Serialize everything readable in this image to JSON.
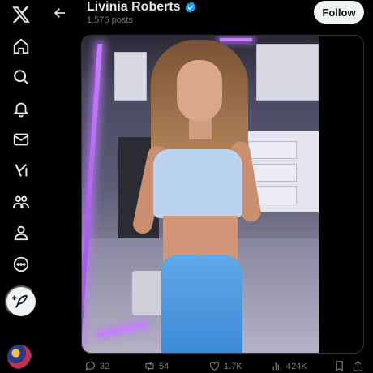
{
  "header": {
    "title": "Livinia Roberts",
    "post_count": "1,576 posts",
    "follow_label": "Follow"
  },
  "nav": {
    "items": [
      {
        "name": "x-logo",
        "icon": "x-logo-icon"
      },
      {
        "name": "home",
        "icon": "home-icon"
      },
      {
        "name": "explore",
        "icon": "search-icon"
      },
      {
        "name": "notifications",
        "icon": "bell-icon"
      },
      {
        "name": "messages",
        "icon": "envelope-icon"
      },
      {
        "name": "grok",
        "icon": "grok-icon"
      },
      {
        "name": "communities",
        "icon": "people-icon"
      },
      {
        "name": "profile",
        "icon": "person-icon"
      },
      {
        "name": "more",
        "icon": "more-circle-icon"
      }
    ],
    "post_button_icon": "feather-plus-icon"
  },
  "actions": {
    "replies": "32",
    "reposts": "54",
    "likes": "1.7K",
    "views": "424K"
  },
  "colors": {
    "background": "#000000",
    "text_primary": "#e7e9ea",
    "text_secondary": "#71767b",
    "verified_blue": "#1d9bf0",
    "button_light": "#eff3f4"
  }
}
